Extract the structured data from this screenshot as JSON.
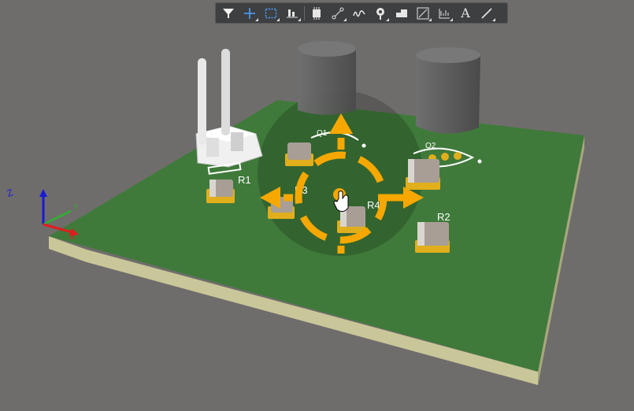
{
  "toolbar": {
    "buttons": [
      {
        "name": "filter-icon",
        "has_dropdown": false
      },
      {
        "name": "crosshair-icon",
        "has_dropdown": true
      },
      {
        "name": "select-rectangle-icon",
        "has_dropdown": true
      },
      {
        "name": "align-icon",
        "has_dropdown": true
      },
      {
        "name": "component-icon",
        "has_dropdown": false
      },
      {
        "name": "route-icon",
        "has_dropdown": true
      },
      {
        "name": "track-icon",
        "has_dropdown": false
      },
      {
        "name": "via-icon",
        "has_dropdown": true
      },
      {
        "name": "polygon-fill-icon",
        "has_dropdown": false
      },
      {
        "name": "dimension-icon",
        "has_dropdown": true
      },
      {
        "name": "graph-icon",
        "has_dropdown": true
      },
      {
        "name": "text-icon",
        "has_dropdown": false
      },
      {
        "name": "line-icon",
        "has_dropdown": true
      }
    ],
    "text_tool_glyph": "A"
  },
  "board": {
    "pcb_color": "#3f7a3a",
    "edge_color": "#c9c699",
    "labels": {
      "r1": "R1",
      "r2": "R2",
      "r3": "R3",
      "r4": "R4",
      "q1": "Q1",
      "q2": "Q2"
    }
  },
  "axes": {
    "x": "X",
    "y": "Y",
    "z": "Z"
  },
  "colors": {
    "move_gizmo": "#f6a800",
    "background": "#6f6d6b"
  }
}
